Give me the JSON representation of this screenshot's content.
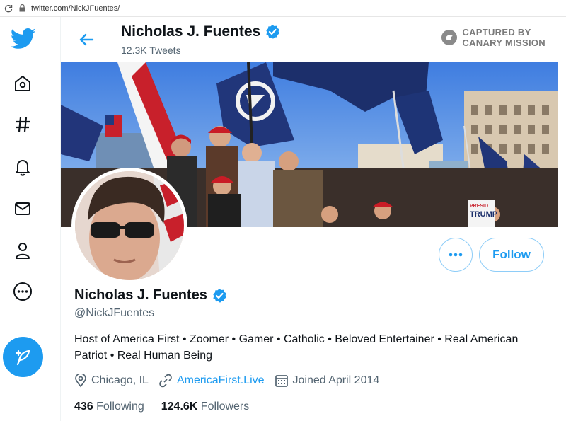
{
  "browser": {
    "url": "twitter.com/NickJFuentes/"
  },
  "nav": {
    "items": [
      "twitter-logo",
      "home",
      "explore",
      "notifications",
      "messages",
      "profile",
      "more"
    ],
    "brand_color": "#1d9bf0"
  },
  "header": {
    "name": "Nicholas J. Fuentes",
    "tweets_count": "12.3K Tweets"
  },
  "watermark": {
    "text": "CAPTURED BY\nCANARY MISSION"
  },
  "profile": {
    "name": "Nicholas J. Fuentes",
    "handle": "@NickJFuentes",
    "bio": "Host of America First • Zoomer • Gamer • Catholic • Beloved Entertainer • Real American Patriot • Real Human Being",
    "location": "Chicago, IL",
    "website": "AmericaFirst.Live",
    "joined": "Joined April 2014",
    "following_count": "436",
    "following_label": "Following",
    "followers_count": "124.6K",
    "followers_label": "Followers",
    "verified": true
  },
  "buttons": {
    "more": "•••",
    "follow": "Follow"
  },
  "banner_text": {
    "sign": "TRUMP",
    "sign_small": "PRESID"
  }
}
